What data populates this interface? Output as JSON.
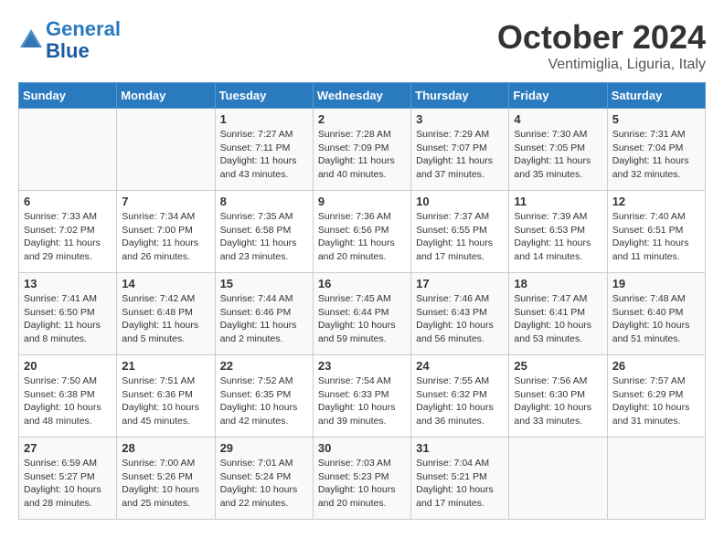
{
  "header": {
    "logo_line1": "General",
    "logo_line2": "Blue",
    "month": "October 2024",
    "location": "Ventimiglia, Liguria, Italy"
  },
  "weekdays": [
    "Sunday",
    "Monday",
    "Tuesday",
    "Wednesday",
    "Thursday",
    "Friday",
    "Saturday"
  ],
  "weeks": [
    [
      {
        "day": "",
        "sunrise": "",
        "sunset": "",
        "daylight": ""
      },
      {
        "day": "",
        "sunrise": "",
        "sunset": "",
        "daylight": ""
      },
      {
        "day": "1",
        "sunrise": "Sunrise: 7:27 AM",
        "sunset": "Sunset: 7:11 PM",
        "daylight": "Daylight: 11 hours and 43 minutes."
      },
      {
        "day": "2",
        "sunrise": "Sunrise: 7:28 AM",
        "sunset": "Sunset: 7:09 PM",
        "daylight": "Daylight: 11 hours and 40 minutes."
      },
      {
        "day": "3",
        "sunrise": "Sunrise: 7:29 AM",
        "sunset": "Sunset: 7:07 PM",
        "daylight": "Daylight: 11 hours and 37 minutes."
      },
      {
        "day": "4",
        "sunrise": "Sunrise: 7:30 AM",
        "sunset": "Sunset: 7:05 PM",
        "daylight": "Daylight: 11 hours and 35 minutes."
      },
      {
        "day": "5",
        "sunrise": "Sunrise: 7:31 AM",
        "sunset": "Sunset: 7:04 PM",
        "daylight": "Daylight: 11 hours and 32 minutes."
      }
    ],
    [
      {
        "day": "6",
        "sunrise": "Sunrise: 7:33 AM",
        "sunset": "Sunset: 7:02 PM",
        "daylight": "Daylight: 11 hours and 29 minutes."
      },
      {
        "day": "7",
        "sunrise": "Sunrise: 7:34 AM",
        "sunset": "Sunset: 7:00 PM",
        "daylight": "Daylight: 11 hours and 26 minutes."
      },
      {
        "day": "8",
        "sunrise": "Sunrise: 7:35 AM",
        "sunset": "Sunset: 6:58 PM",
        "daylight": "Daylight: 11 hours and 23 minutes."
      },
      {
        "day": "9",
        "sunrise": "Sunrise: 7:36 AM",
        "sunset": "Sunset: 6:56 PM",
        "daylight": "Daylight: 11 hours and 20 minutes."
      },
      {
        "day": "10",
        "sunrise": "Sunrise: 7:37 AM",
        "sunset": "Sunset: 6:55 PM",
        "daylight": "Daylight: 11 hours and 17 minutes."
      },
      {
        "day": "11",
        "sunrise": "Sunrise: 7:39 AM",
        "sunset": "Sunset: 6:53 PM",
        "daylight": "Daylight: 11 hours and 14 minutes."
      },
      {
        "day": "12",
        "sunrise": "Sunrise: 7:40 AM",
        "sunset": "Sunset: 6:51 PM",
        "daylight": "Daylight: 11 hours and 11 minutes."
      }
    ],
    [
      {
        "day": "13",
        "sunrise": "Sunrise: 7:41 AM",
        "sunset": "Sunset: 6:50 PM",
        "daylight": "Daylight: 11 hours and 8 minutes."
      },
      {
        "day": "14",
        "sunrise": "Sunrise: 7:42 AM",
        "sunset": "Sunset: 6:48 PM",
        "daylight": "Daylight: 11 hours and 5 minutes."
      },
      {
        "day": "15",
        "sunrise": "Sunrise: 7:44 AM",
        "sunset": "Sunset: 6:46 PM",
        "daylight": "Daylight: 11 hours and 2 minutes."
      },
      {
        "day": "16",
        "sunrise": "Sunrise: 7:45 AM",
        "sunset": "Sunset: 6:44 PM",
        "daylight": "Daylight: 10 hours and 59 minutes."
      },
      {
        "day": "17",
        "sunrise": "Sunrise: 7:46 AM",
        "sunset": "Sunset: 6:43 PM",
        "daylight": "Daylight: 10 hours and 56 minutes."
      },
      {
        "day": "18",
        "sunrise": "Sunrise: 7:47 AM",
        "sunset": "Sunset: 6:41 PM",
        "daylight": "Daylight: 10 hours and 53 minutes."
      },
      {
        "day": "19",
        "sunrise": "Sunrise: 7:48 AM",
        "sunset": "Sunset: 6:40 PM",
        "daylight": "Daylight: 10 hours and 51 minutes."
      }
    ],
    [
      {
        "day": "20",
        "sunrise": "Sunrise: 7:50 AM",
        "sunset": "Sunset: 6:38 PM",
        "daylight": "Daylight: 10 hours and 48 minutes."
      },
      {
        "day": "21",
        "sunrise": "Sunrise: 7:51 AM",
        "sunset": "Sunset: 6:36 PM",
        "daylight": "Daylight: 10 hours and 45 minutes."
      },
      {
        "day": "22",
        "sunrise": "Sunrise: 7:52 AM",
        "sunset": "Sunset: 6:35 PM",
        "daylight": "Daylight: 10 hours and 42 minutes."
      },
      {
        "day": "23",
        "sunrise": "Sunrise: 7:54 AM",
        "sunset": "Sunset: 6:33 PM",
        "daylight": "Daylight: 10 hours and 39 minutes."
      },
      {
        "day": "24",
        "sunrise": "Sunrise: 7:55 AM",
        "sunset": "Sunset: 6:32 PM",
        "daylight": "Daylight: 10 hours and 36 minutes."
      },
      {
        "day": "25",
        "sunrise": "Sunrise: 7:56 AM",
        "sunset": "Sunset: 6:30 PM",
        "daylight": "Daylight: 10 hours and 33 minutes."
      },
      {
        "day": "26",
        "sunrise": "Sunrise: 7:57 AM",
        "sunset": "Sunset: 6:29 PM",
        "daylight": "Daylight: 10 hours and 31 minutes."
      }
    ],
    [
      {
        "day": "27",
        "sunrise": "Sunrise: 6:59 AM",
        "sunset": "Sunset: 5:27 PM",
        "daylight": "Daylight: 10 hours and 28 minutes."
      },
      {
        "day": "28",
        "sunrise": "Sunrise: 7:00 AM",
        "sunset": "Sunset: 5:26 PM",
        "daylight": "Daylight: 10 hours and 25 minutes."
      },
      {
        "day": "29",
        "sunrise": "Sunrise: 7:01 AM",
        "sunset": "Sunset: 5:24 PM",
        "daylight": "Daylight: 10 hours and 22 minutes."
      },
      {
        "day": "30",
        "sunrise": "Sunrise: 7:03 AM",
        "sunset": "Sunset: 5:23 PM",
        "daylight": "Daylight: 10 hours and 20 minutes."
      },
      {
        "day": "31",
        "sunrise": "Sunrise: 7:04 AM",
        "sunset": "Sunset: 5:21 PM",
        "daylight": "Daylight: 10 hours and 17 minutes."
      },
      {
        "day": "",
        "sunrise": "",
        "sunset": "",
        "daylight": ""
      },
      {
        "day": "",
        "sunrise": "",
        "sunset": "",
        "daylight": ""
      }
    ]
  ]
}
